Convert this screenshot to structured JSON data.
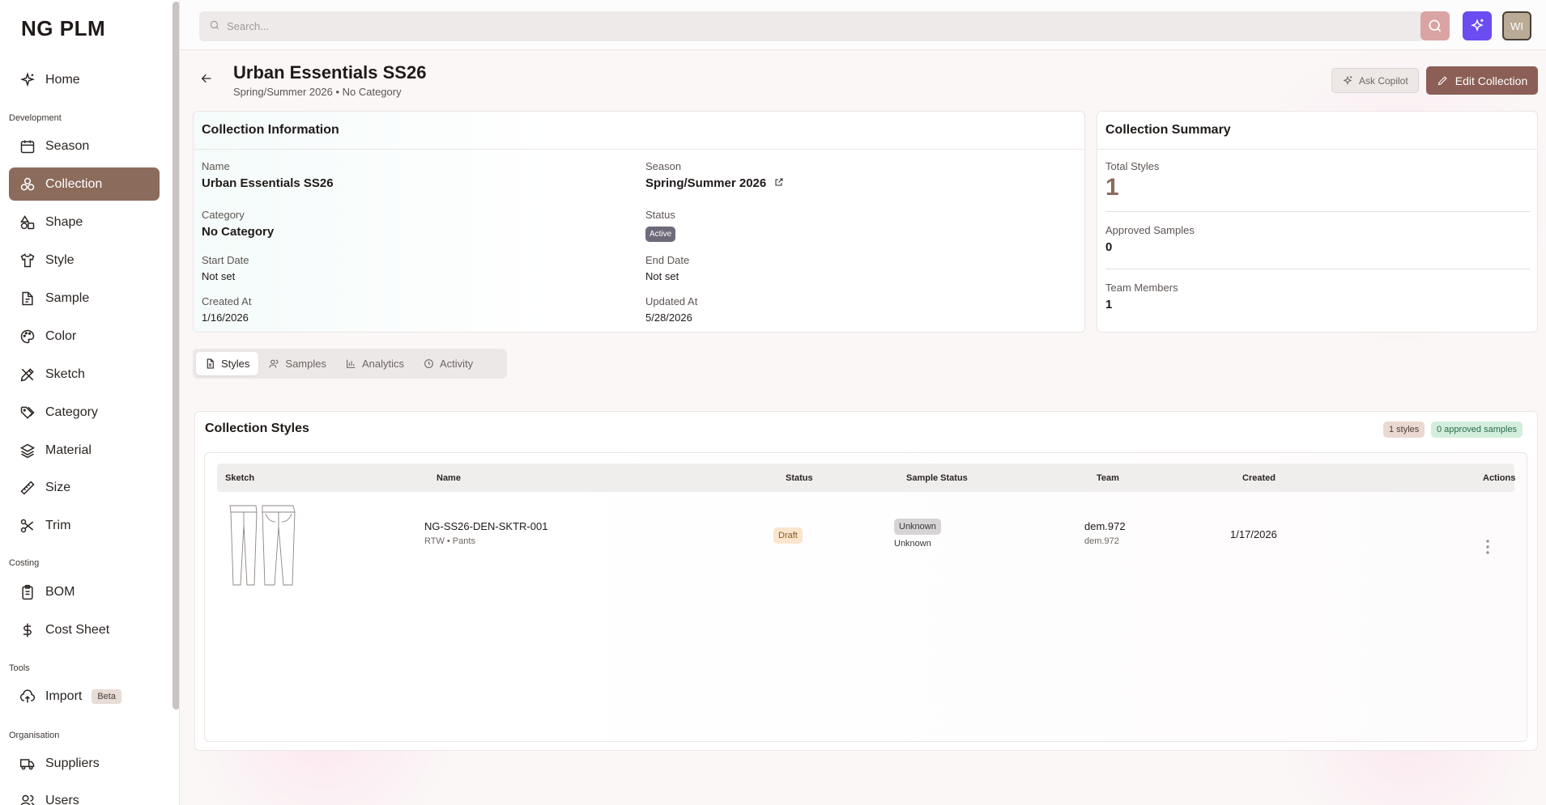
{
  "app": {
    "logo": "NG PLM"
  },
  "sidebar": {
    "sections": {
      "development": "Development",
      "costing": "Costing",
      "tools": "Tools",
      "organisation": "Organisation"
    },
    "items": [
      {
        "label": "Home",
        "icon": "home-sparkle-icon"
      },
      {
        "label": "Season",
        "icon": "calendar-icon"
      },
      {
        "label": "Collection",
        "icon": "collection-icon",
        "active": true
      },
      {
        "label": "Shape",
        "icon": "shapes-icon"
      },
      {
        "label": "Style",
        "icon": "shirt-icon"
      },
      {
        "label": "Sample",
        "icon": "sample-icon"
      },
      {
        "label": "Color",
        "icon": "palette-icon"
      },
      {
        "label": "Sketch",
        "icon": "sketch-icon"
      },
      {
        "label": "Category",
        "icon": "tags-icon"
      },
      {
        "label": "Material",
        "icon": "layers-icon"
      },
      {
        "label": "Size",
        "icon": "ruler-icon"
      },
      {
        "label": "Trim",
        "icon": "scissors-icon"
      },
      {
        "label": "BOM",
        "icon": "clipboard-icon"
      },
      {
        "label": "Cost Sheet",
        "icon": "dollar-icon"
      },
      {
        "label": "Import",
        "icon": "cloud-upload-icon",
        "badge": "Beta"
      },
      {
        "label": "Suppliers",
        "icon": "truck-icon"
      },
      {
        "label": "Users",
        "icon": "users-icon"
      }
    ]
  },
  "topbar": {
    "search_placeholder": "Search...",
    "avatar_initials": "WI"
  },
  "header": {
    "title": "Urban Essentials SS26",
    "subtitle": "Spring/Summer 2026 • No Category",
    "copilot_label": "Ask Copilot",
    "edit_label": "Edit Collection"
  },
  "info": {
    "title": "Collection Information",
    "name_label": "Name",
    "name": "Urban Essentials SS26",
    "season_label": "Season",
    "season": "Spring/Summer 2026",
    "category_label": "Category",
    "category": "No Category",
    "status_label": "Status",
    "status": "Active",
    "start_label": "Start Date",
    "start": "Not set",
    "end_label": "End Date",
    "end": "Not set",
    "created_label": "Created At",
    "created": "1/16/2026",
    "updated_label": "Updated At",
    "updated": "5/28/2026"
  },
  "summary": {
    "title": "Collection Summary",
    "total_styles_label": "Total Styles",
    "total_styles": "1",
    "approved_label": "Approved Samples",
    "approved": "0",
    "team_label": "Team Members",
    "team": "1"
  },
  "tabs": [
    {
      "label": "Styles",
      "icon": "document-icon",
      "active": true
    },
    {
      "label": "Samples",
      "icon": "users-icon"
    },
    {
      "label": "Analytics",
      "icon": "bar-chart-icon"
    },
    {
      "label": "Activity",
      "icon": "clock-icon"
    }
  ],
  "styles": {
    "title": "Collection Styles",
    "badge_styles": "1 styles",
    "badge_approved": "0 approved samples",
    "columns": [
      "Sketch",
      "Name",
      "Status",
      "Sample Status",
      "Team",
      "Created",
      "Actions"
    ],
    "rows": [
      {
        "name": "NG-SS26-DEN-SKTR-001",
        "meta": "RTW • Pants",
        "status": "Draft",
        "sample_status": "Unknown",
        "sample_status_sub": "Unknown",
        "team": "dem.972",
        "team_sub": "dem.972",
        "created": "1/17/2026"
      }
    ]
  },
  "colors": {
    "accent": "#8b6b5c",
    "edit_button": "#8b5f55",
    "ai_button": "#6a4cf0",
    "search_button": "#d9a4a3"
  }
}
